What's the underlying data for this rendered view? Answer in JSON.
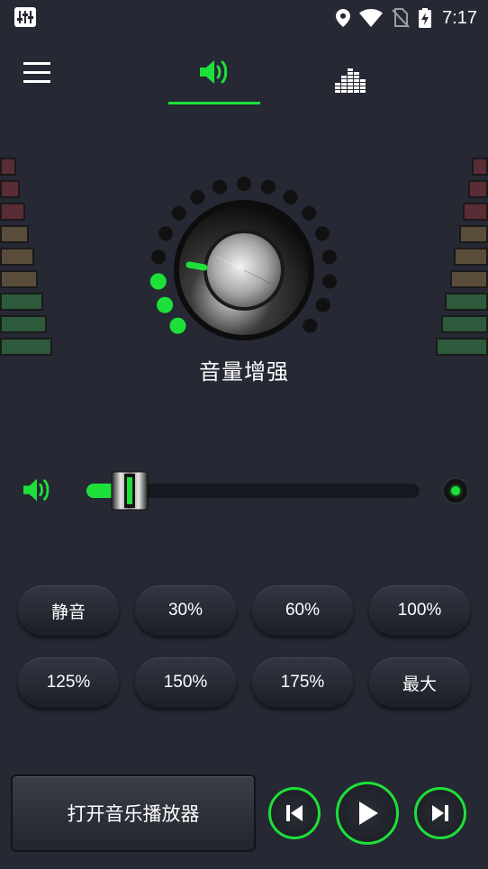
{
  "status": {
    "time": "7:17",
    "icons": [
      "equalizer-app-icon",
      "location-icon",
      "wifi-icon",
      "no-sim-icon",
      "battery-charging-icon"
    ]
  },
  "nav": {
    "menu_icon": "hamburger-menu-icon",
    "tabs": [
      {
        "icon": "speaker-volume-icon",
        "active": true
      },
      {
        "icon": "equalizer-bars-icon",
        "active": false
      }
    ]
  },
  "knob": {
    "title": "音量增强",
    "active_dots": 3,
    "total_dots": 17
  },
  "vu_meter": {
    "colors": [
      "#5a2c36",
      "#5a2c36",
      "#5a2c36",
      "#5a4c3a",
      "#5a4c3a",
      "#5a4c3a",
      "#2c5a3a",
      "#2c5a3a",
      "#2c5a3a"
    ]
  },
  "slider": {
    "level": 0.1,
    "accent": "#1ee03a"
  },
  "presets": [
    "静音",
    "30%",
    "60%",
    "100%",
    "125%",
    "150%",
    "175%",
    "最大"
  ],
  "player": {
    "open_label": "打开音乐播放器",
    "controls": [
      "skip-previous-icon",
      "play-icon",
      "skip-next-icon"
    ]
  },
  "colors": {
    "background": "#262934",
    "accent": "#1ee03a"
  }
}
